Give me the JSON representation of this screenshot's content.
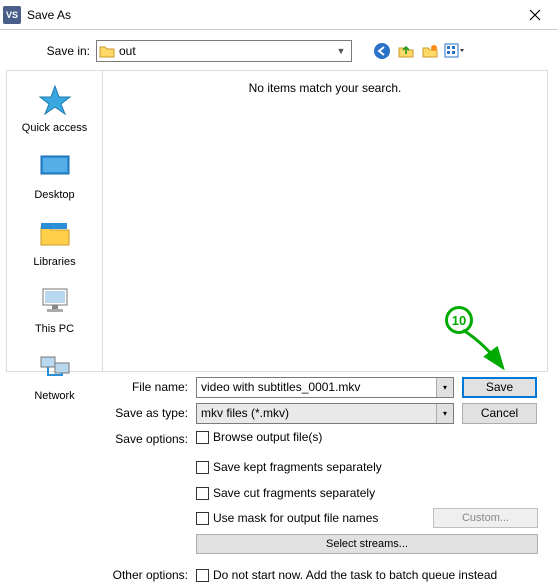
{
  "window": {
    "title": "Save As",
    "app_icon_text": "VS"
  },
  "savein": {
    "label": "Save in:",
    "value": "out"
  },
  "places": {
    "quick_access": "Quick access",
    "desktop": "Desktop",
    "libraries": "Libraries",
    "this_pc": "This PC",
    "network": "Network"
  },
  "filelist": {
    "empty": "No items match your search."
  },
  "form": {
    "file_name_label": "File name:",
    "file_name_value": "video with subtitles_0001.mkv",
    "save_type_label": "Save as type:",
    "save_type_value": "mkv files (*.mkv)",
    "save_options_label": "Save options:",
    "other_options_label": "Other options:"
  },
  "buttons": {
    "save": "Save",
    "cancel": "Cancel",
    "custom": "Custom...",
    "select_streams": "Select streams..."
  },
  "checks": {
    "browse": "Browse output file(s)",
    "save_kept": "Save kept fragments separately",
    "save_cut": "Save cut fragments separately",
    "use_mask": "Use mask for output file names",
    "batch": "Do not start now. Add the task to batch queue instead"
  },
  "annotation": {
    "step": "10"
  }
}
